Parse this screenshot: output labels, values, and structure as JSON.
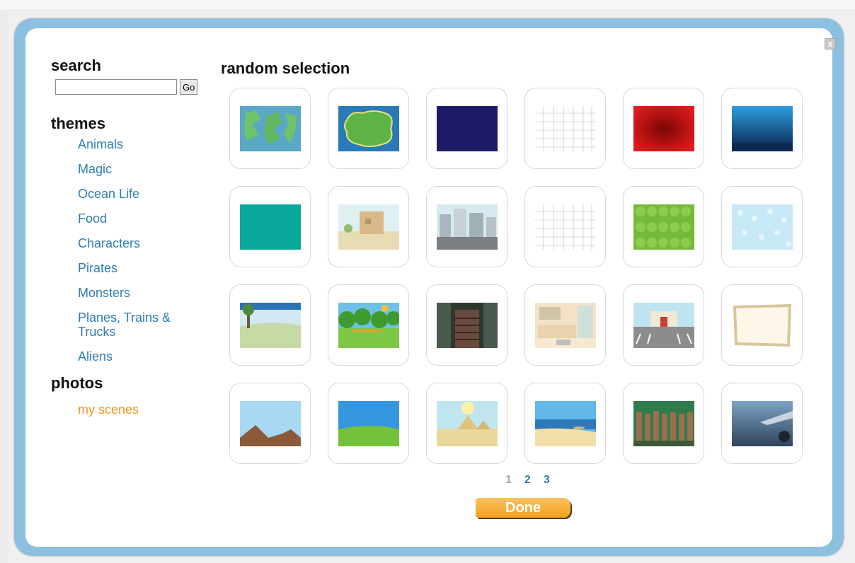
{
  "window": {
    "close_label": "x"
  },
  "sidebar": {
    "search_title": "search",
    "search_placeholder": "",
    "go_label": "Go",
    "themes_title": "themes",
    "themes": [
      "Animals",
      "Magic",
      "Ocean Life",
      "Food",
      "Characters",
      "Pirates",
      "Monsters",
      "Planes, Trains & Trucks",
      "Aliens"
    ],
    "photos_title": "photos",
    "my_scenes": "my scenes"
  },
  "main": {
    "title": "random selection",
    "scenes": [
      "island-map",
      "green-island",
      "navy-blank",
      "grid-paper",
      "red-burst",
      "underwater",
      "teal-blank",
      "desert-castle",
      "city-street",
      "grid-paper",
      "green-scallops",
      "light-blue-pattern",
      "tree-meadow",
      "forest",
      "dark-stairway",
      "kitchen",
      "parking-building",
      "parchment-frame",
      "brown-hills",
      "grass-sky",
      "pyramids",
      "beach",
      "tree-trunks",
      "airplane-window"
    ],
    "pager": {
      "current": "1",
      "pages": [
        "2",
        "3"
      ]
    },
    "done_label": "Done"
  },
  "colors": {
    "modal_border": "#8dbfe0",
    "link": "#2f7db4",
    "accent_orange": "#f2961e",
    "done_button": "#f7ad2f"
  }
}
